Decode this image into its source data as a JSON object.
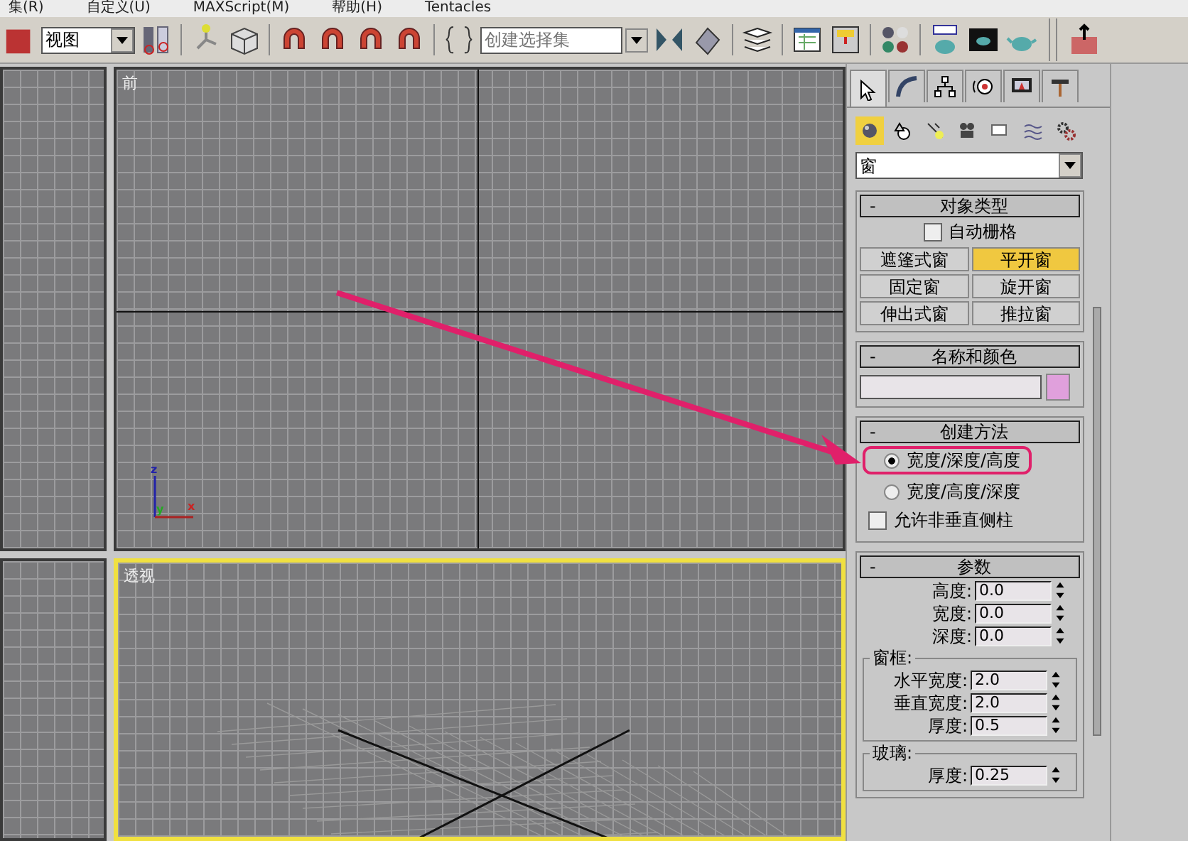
{
  "menu": [
    "集(R)",
    "自定义(U)",
    "MAXScript(M)",
    "帮助(H)",
    "Tentacles"
  ],
  "toolbar": {
    "view_dropdown": "视图",
    "selection_set": {
      "placeholder": "创建选择集"
    }
  },
  "viewports": [
    {
      "label": "前",
      "kind": "ortho",
      "selected": false,
      "axis_labels": [
        "z",
        "y",
        "x"
      ]
    },
    {
      "label": "透视",
      "kind": "perspective",
      "selected": true
    }
  ],
  "command_panel": {
    "tabs": [
      {
        "selected": true
      },
      {
        "selected": false
      },
      {
        "selected": false
      },
      {
        "selected": false
      },
      {
        "selected": false
      },
      {
        "selected": false
      }
    ],
    "categories": [
      {
        "selected": true
      },
      {
        "selected": false
      },
      {
        "selected": false
      },
      {
        "selected": false
      },
      {
        "selected": false
      },
      {
        "selected": false
      },
      {
        "selected": false
      }
    ],
    "category_dropdown": "窗",
    "object_type": {
      "toggle": "-",
      "title": "对象类型",
      "auto_grid": {
        "label": "自动栅格",
        "checked": false
      },
      "buttons": [
        {
          "label": "遮篷式窗",
          "selected": false
        },
        {
          "label": "平开窗",
          "selected": true
        },
        {
          "label": "固定窗",
          "selected": false
        },
        {
          "label": "旋开窗",
          "selected": false
        },
        {
          "label": "伸出式窗",
          "selected": false
        },
        {
          "label": "推拉窗",
          "selected": false
        }
      ]
    },
    "name_color": {
      "toggle": "-",
      "title": "名称和颜色"
    },
    "creation_method": {
      "toggle": "-",
      "title": "创建方法",
      "options": [
        {
          "label": "宽度/深度/高度",
          "selected": true,
          "highlighted": true
        },
        {
          "label": "宽度/高度/深度",
          "selected": false,
          "highlighted": false
        }
      ],
      "allow_checkbox": {
        "label": "允许非垂直侧柱",
        "checked": false
      }
    },
    "parameters": {
      "toggle": "-",
      "title": "参数",
      "fields": [
        {
          "label": "高度:",
          "value": "0.0"
        },
        {
          "label": "宽度:",
          "value": "0.0"
        },
        {
          "label": "深度:",
          "value": "0.0"
        }
      ],
      "frame": {
        "title": "窗框:",
        "fields": [
          {
            "label": "水平宽度:",
            "value": "2.0"
          },
          {
            "label": "垂直宽度:",
            "value": "2.0"
          },
          {
            "label": "厚度:",
            "value": "0.5"
          }
        ]
      },
      "glass": {
        "title": "玻璃:",
        "fields": [
          {
            "label": "厚度:",
            "value": "0.25"
          }
        ]
      }
    }
  }
}
